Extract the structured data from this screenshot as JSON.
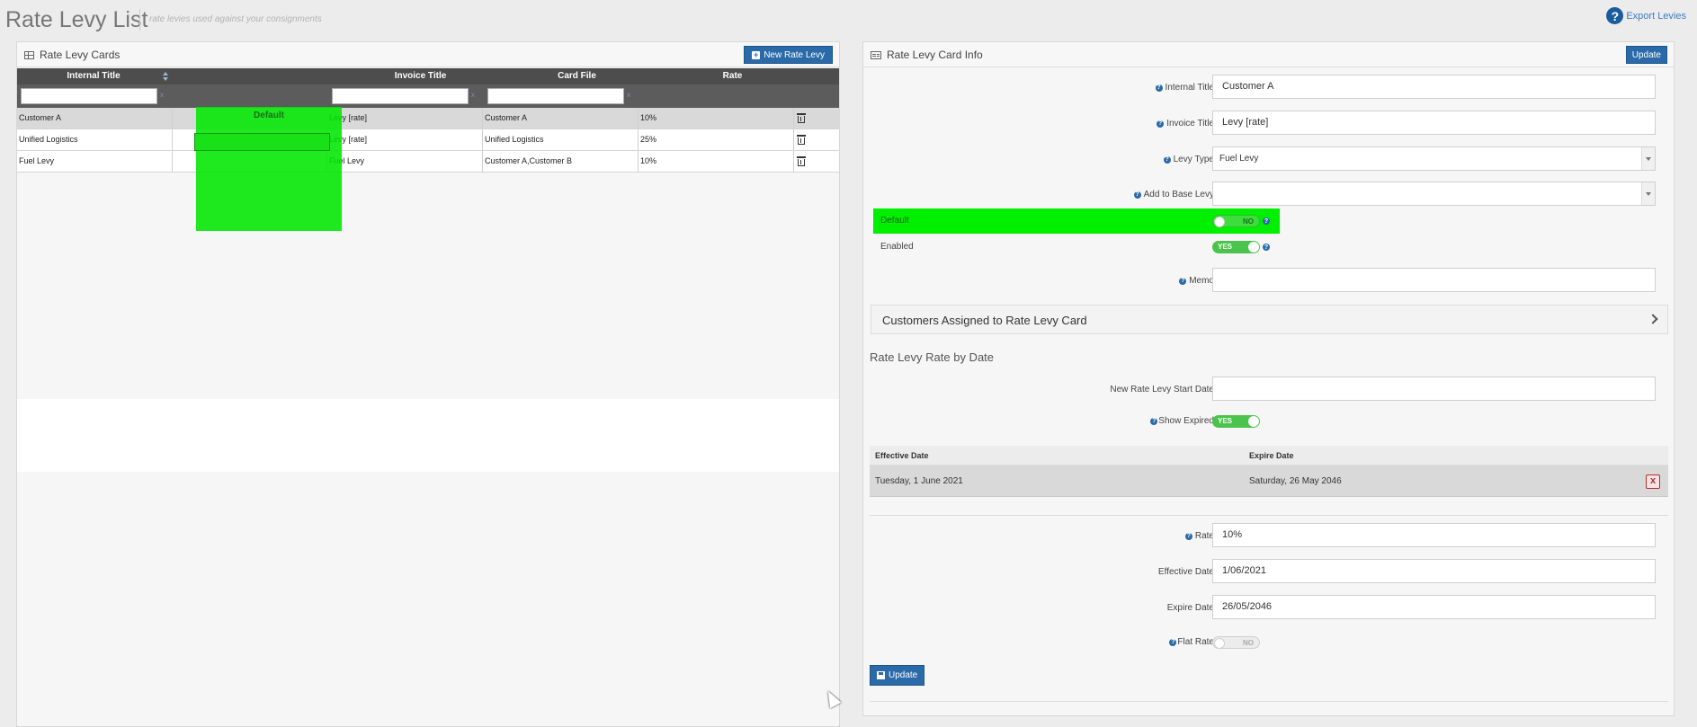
{
  "header": {
    "title": "Rate Levy List",
    "subtitle": "rate levies used against your consignments",
    "export_label": "Export Levies",
    "help_glyph": "?"
  },
  "left_panel": {
    "title": "Rate Levy Cards",
    "new_button": "New Rate Levy",
    "columns": [
      "Internal Title",
      "Default",
      "Invoice Title",
      "Card File",
      "Rate"
    ],
    "filter_clear": "x",
    "rows": [
      {
        "internal_title": "Customer A",
        "default": "",
        "invoice_title": "Levy [rate]",
        "card_file": "Customer A",
        "rate": "10%"
      },
      {
        "internal_title": "Unified Logistics",
        "default": "",
        "invoice_title": "Levy [rate]",
        "card_file": "Unified Logistics",
        "rate": "25%"
      },
      {
        "internal_title": "Fuel Levy",
        "default": "",
        "invoice_title": "Fuel Levy",
        "card_file": "Customer A,Customer B",
        "rate": "10%"
      }
    ]
  },
  "right_panel": {
    "title": "Rate Levy Card Info",
    "update_top": "Update",
    "fields": {
      "internal_title": {
        "label": "Internal Title",
        "value": "Customer A"
      },
      "invoice_title": {
        "label": "Invoice Title",
        "value": "Levy [rate]"
      },
      "levy_type": {
        "label": "Levy Type",
        "value": "Fuel Levy"
      },
      "add_to_base_levy": {
        "label": "Add to Base Levy",
        "value": ""
      },
      "default": {
        "label": "Default",
        "value": "NO"
      },
      "enabled": {
        "label": "Enabled",
        "value": "YES"
      },
      "memo": {
        "label": "Memo",
        "value": ""
      }
    },
    "customers_section": "Customers Assigned to Rate Levy Card",
    "rate_by_date_title": "Rate Levy Rate by Date",
    "new_start_date": {
      "label": "New Rate Levy Start Date",
      "value": ""
    },
    "show_expired": {
      "label": "Show Expired",
      "value": "YES"
    },
    "dates_table": {
      "columns": [
        "Effective Date",
        "Expire Date"
      ],
      "rows": [
        {
          "effective": "Tuesday, 1 June 2021",
          "expire": "Saturday, 26 May 2046"
        }
      ],
      "delete_glyph": "x"
    },
    "rate": {
      "label": "Rate",
      "value": "10%"
    },
    "effective_date": {
      "label": "Effective Date",
      "value": "1/06/2021"
    },
    "expire_date": {
      "label": "Expire Date",
      "value": "26/05/2046"
    },
    "flat_rate": {
      "label": "Flat Rate",
      "value": "NO"
    },
    "update_bottom": "Update",
    "question_glyph": "?"
  },
  "colors": {
    "accent": "#2a6aa9",
    "highlight": "#00f000",
    "toggle_on": "#4cc34c",
    "header_dark": "#4d4d4d"
  }
}
